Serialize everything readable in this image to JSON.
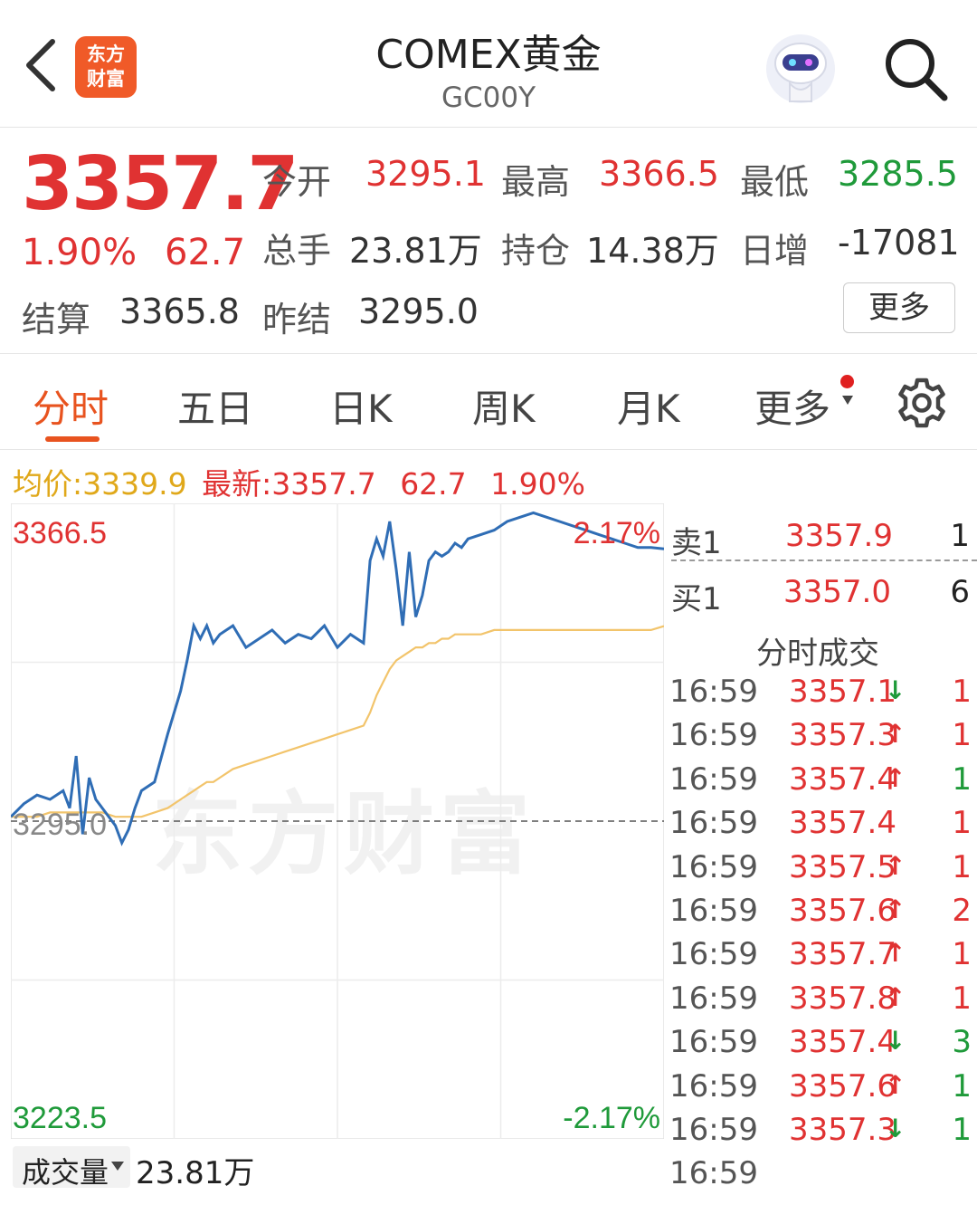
{
  "header": {
    "logo_line1": "东方",
    "logo_line2": "财富",
    "title": "COMEX黄金",
    "code": "GC00Y"
  },
  "quote": {
    "price": "3357.7",
    "change_pct": "1.90%",
    "change": "62.7",
    "open_label": "今开",
    "open": "3295.1",
    "high_label": "最高",
    "high": "3366.5",
    "low_label": "最低",
    "low": "3285.5",
    "volume_label": "总手",
    "volume": "23.81万",
    "oi_label": "持仓",
    "oi": "14.38万",
    "daily_inc_label": "日增",
    "daily_inc": "-17081",
    "settle_label": "结算",
    "settle": "3365.8",
    "prev_settle_label": "昨结",
    "prev_settle": "3295.0",
    "more_label": "更多"
  },
  "tabs": [
    {
      "label": "分时",
      "active": true
    },
    {
      "label": "五日"
    },
    {
      "label": "日K"
    },
    {
      "label": "周K"
    },
    {
      "label": "月K"
    },
    {
      "label": "更多"
    }
  ],
  "infoline": {
    "avg_label": "均价:",
    "avg": "3339.9",
    "latest_label": "最新:",
    "latest": "3357.7",
    "change": "62.7",
    "pct": "1.90%"
  },
  "chart_data": {
    "type": "line",
    "y_top_label": "3366.5",
    "y_mid_label": "3295.0",
    "y_bottom_label": "3223.5",
    "pct_top_label": "2.17%",
    "pct_bottom_label": "-2.17%",
    "ylim": [
      3223.5,
      3366.5
    ],
    "reference": 3295.0,
    "x": [
      0,
      2,
      4,
      6,
      8,
      9,
      10,
      11,
      12,
      13,
      14,
      16,
      17,
      18,
      19,
      20,
      22,
      24,
      26,
      27,
      28,
      29,
      30,
      31,
      32,
      33,
      34,
      36,
      38,
      40,
      42,
      44,
      46,
      48,
      50,
      52,
      54,
      55,
      56,
      57,
      58,
      59,
      60,
      61,
      62,
      63,
      64,
      65,
      66,
      67,
      68,
      69,
      70,
      72,
      74,
      76,
      78,
      80,
      82,
      84,
      86,
      88,
      90,
      92,
      94,
      96,
      98,
      100
    ],
    "series": [
      {
        "values": [
          3296,
          3299,
          3301,
          3300,
          3302,
          3298,
          3310,
          3292,
          3305,
          3300,
          3298,
          3294,
          3290,
          3293,
          3298,
          3302,
          3304,
          3315,
          3325,
          3332,
          3340,
          3337,
          3340,
          3336,
          3338,
          3339,
          3340,
          3335,
          3337,
          3339,
          3336,
          3338,
          3337,
          3340,
          3335,
          3338,
          3336,
          3355,
          3360,
          3356,
          3364,
          3353,
          3340,
          3357,
          3342,
          3347,
          3355,
          3357,
          3356,
          3357,
          3359,
          3358,
          3360,
          3361,
          3362,
          3364,
          3365,
          3366,
          3365,
          3364,
          3363,
          3362,
          3361,
          3360,
          3359,
          3358,
          3358,
          3357.7
        ]
      },
      {
        "values": [
          3296,
          3296,
          3296,
          3297,
          3297,
          3297,
          3297,
          3297,
          3297,
          3297,
          3297,
          3296,
          3296,
          3296,
          3296,
          3296,
          3297,
          3298,
          3300,
          3301,
          3302,
          3303,
          3304,
          3304,
          3305,
          3306,
          3307,
          3308,
          3309,
          3310,
          3311,
          3312,
          3313,
          3314,
          3315,
          3316,
          3317,
          3320,
          3324,
          3327,
          3330,
          3332,
          3333,
          3334,
          3335,
          3335,
          3336,
          3336,
          3337,
          3337,
          3338,
          3338,
          3338,
          3338,
          3339,
          3339,
          3339,
          3339,
          3339,
          3339,
          3339,
          3339,
          3339,
          3339,
          3339,
          3339,
          3339,
          3339.9
        ]
      }
    ]
  },
  "orderbook": {
    "ask_label": "卖1",
    "ask_price": "3357.9",
    "ask_vol": "1",
    "bid_label": "买1",
    "bid_price": "3357.0",
    "bid_vol": "6"
  },
  "ticks": {
    "title": "分时成交",
    "rows": [
      {
        "time": "16:59",
        "price": "3357.1",
        "arrow": "↓",
        "vol": "1",
        "vol_color": "red",
        "arrow_color": "green"
      },
      {
        "time": "16:59",
        "price": "3357.3",
        "arrow": "↑",
        "vol": "1",
        "vol_color": "red",
        "arrow_color": "red"
      },
      {
        "time": "16:59",
        "price": "3357.4",
        "arrow": "↑",
        "vol": "1",
        "vol_color": "green",
        "arrow_color": "red"
      },
      {
        "time": "16:59",
        "price": "3357.4",
        "arrow": "",
        "vol": "1",
        "vol_color": "red",
        "arrow_color": "red"
      },
      {
        "time": "16:59",
        "price": "3357.5",
        "arrow": "↑",
        "vol": "1",
        "vol_color": "red",
        "arrow_color": "red"
      },
      {
        "time": "16:59",
        "price": "3357.6",
        "arrow": "↑",
        "vol": "2",
        "vol_color": "red",
        "arrow_color": "red"
      },
      {
        "time": "16:59",
        "price": "3357.7",
        "arrow": "↑",
        "vol": "1",
        "vol_color": "red",
        "arrow_color": "red"
      },
      {
        "time": "16:59",
        "price": "3357.8",
        "arrow": "↑",
        "vol": "1",
        "vol_color": "red",
        "arrow_color": "red"
      },
      {
        "time": "16:59",
        "price": "3357.4",
        "arrow": "↓",
        "vol": "3",
        "vol_color": "green",
        "arrow_color": "green"
      },
      {
        "time": "16:59",
        "price": "3357.6",
        "arrow": "↑",
        "vol": "1",
        "vol_color": "green",
        "arrow_color": "red"
      },
      {
        "time": "16:59",
        "price": "3357.3",
        "arrow": "↓",
        "vol": "1",
        "vol_color": "green",
        "arrow_color": "green"
      },
      {
        "time": "16:59",
        "price": "",
        "arrow": "",
        "vol": "",
        "vol_color": "red",
        "arrow_color": "red"
      }
    ]
  },
  "volume": {
    "label": "成交量",
    "value": "23.81万"
  },
  "watermark": "东方财富",
  "colors": {
    "up": "#e03232",
    "down": "#1f9a3a",
    "price_line": "#2f6db5",
    "avg_line": "#f2c46b",
    "brand": "#f05a28"
  }
}
